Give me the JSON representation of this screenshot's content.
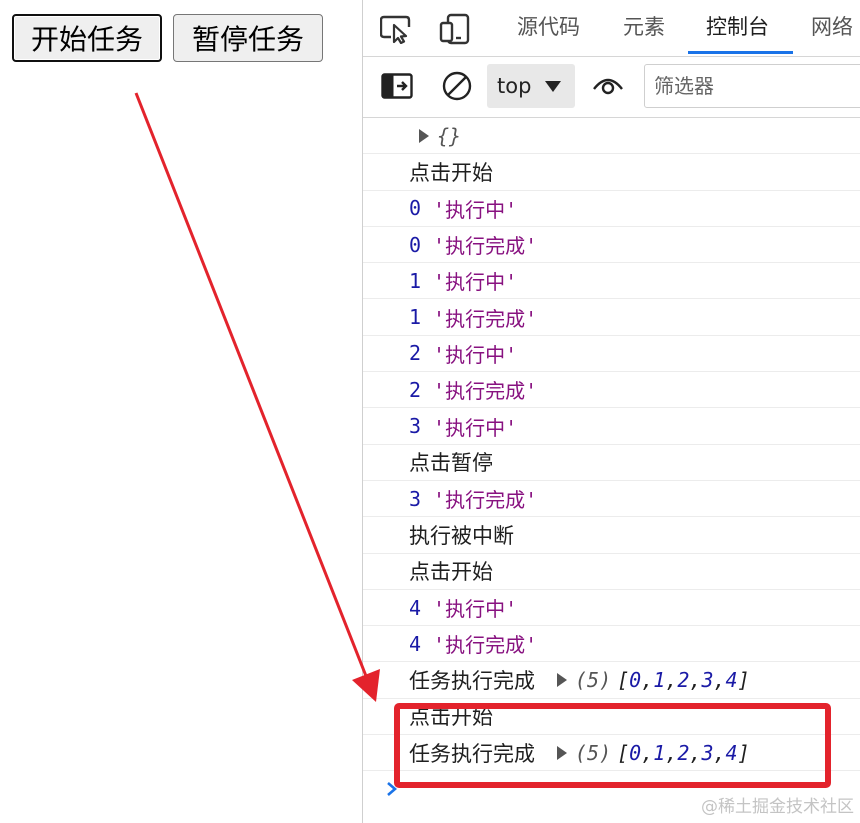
{
  "page": {
    "start_button": "开始任务",
    "pause_button": "暂停任务"
  },
  "devtools": {
    "tabs": [
      {
        "label": "源代码"
      },
      {
        "label": "元素"
      },
      {
        "label": "控制台",
        "active": true
      },
      {
        "label": "网络"
      }
    ],
    "toolbar": {
      "context": "top",
      "filter_placeholder": "筛选器"
    },
    "console": {
      "first_row_object": "{}",
      "rows": [
        {
          "type": "text",
          "text": "点击开始"
        },
        {
          "type": "log",
          "num": "0",
          "str": "'执行中'"
        },
        {
          "type": "log",
          "num": "0",
          "str": "'执行完成'"
        },
        {
          "type": "log",
          "num": "1",
          "str": "'执行中'"
        },
        {
          "type": "log",
          "num": "1",
          "str": "'执行完成'"
        },
        {
          "type": "log",
          "num": "2",
          "str": "'执行中'"
        },
        {
          "type": "log",
          "num": "2",
          "str": "'执行完成'"
        },
        {
          "type": "log",
          "num": "3",
          "str": "'执行中'"
        },
        {
          "type": "text",
          "text": "点击暂停"
        },
        {
          "type": "log",
          "num": "3",
          "str": "'执行完成'"
        },
        {
          "type": "text",
          "text": "执行被中断"
        },
        {
          "type": "text",
          "text": "点击开始"
        },
        {
          "type": "log",
          "num": "4",
          "str": "'执行中'"
        },
        {
          "type": "log",
          "num": "4",
          "str": "'执行完成'"
        },
        {
          "type": "array",
          "text": "任务执行完成",
          "len": "(5)",
          "items": [
            "0",
            "1",
            "2",
            "3",
            "4"
          ]
        },
        {
          "type": "text",
          "text": "点击开始"
        },
        {
          "type": "array",
          "text": "任务执行完成",
          "len": "(5)",
          "items": [
            "0",
            "1",
            "2",
            "3",
            "4"
          ]
        }
      ]
    }
  },
  "annotation": {
    "color": "#e3232c"
  },
  "watermark": "@稀土掘金技术社区"
}
